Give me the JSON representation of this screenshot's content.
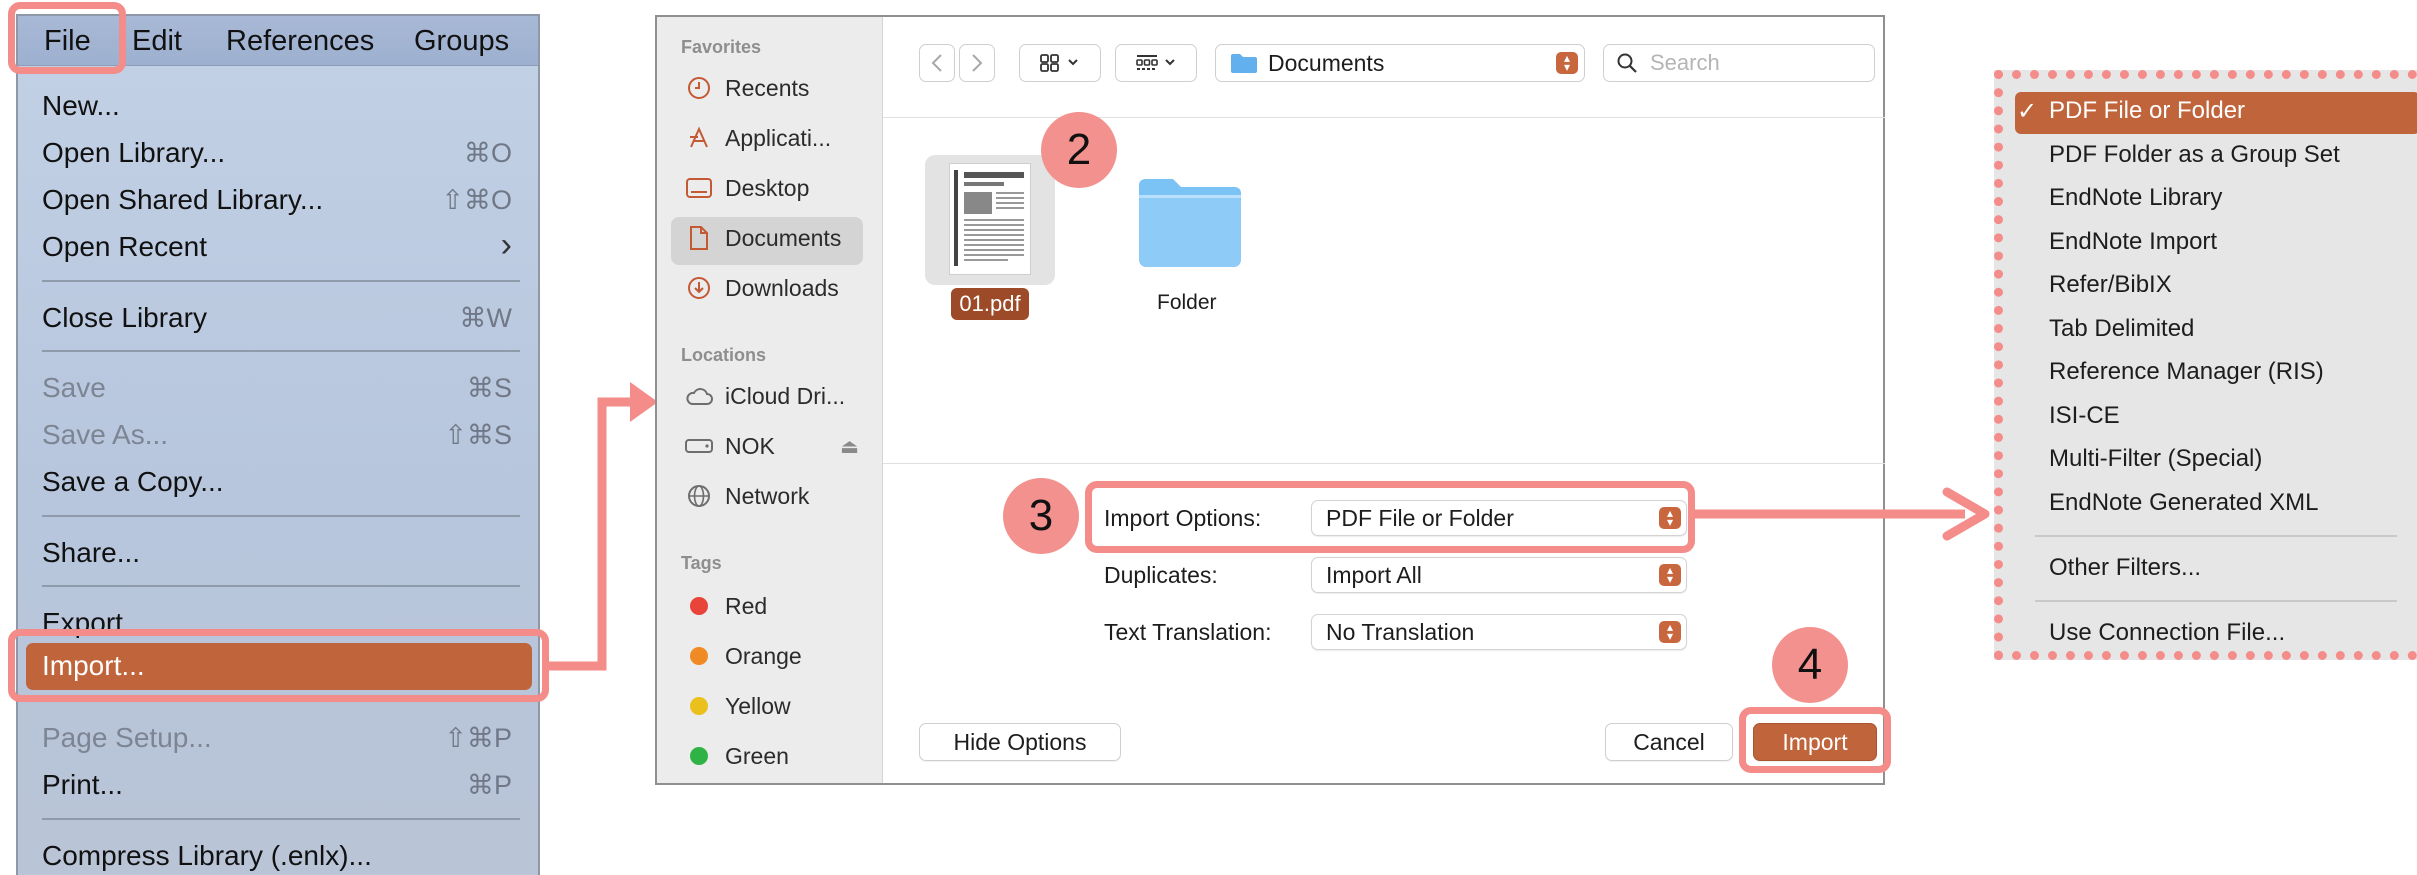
{
  "menu": {
    "bar": [
      "File",
      "Edit",
      "References",
      "Groups"
    ],
    "items": [
      {
        "label": "New...",
        "shortcut": ""
      },
      {
        "label": "Open Library...",
        "shortcut": "⌘O"
      },
      {
        "label": "Open Shared Library...",
        "shortcut": "⇧⌘O"
      },
      {
        "label": "Open Recent",
        "shortcut": "›"
      },
      {
        "label": "Close Library",
        "shortcut": "⌘W"
      },
      {
        "label": "Save",
        "shortcut": "⌘S"
      },
      {
        "label": "Save As...",
        "shortcut": "⇧⌘S"
      },
      {
        "label": "Save a Copy...",
        "shortcut": ""
      },
      {
        "label": "Share...",
        "shortcut": ""
      },
      {
        "label": "Export...",
        "shortcut": ""
      },
      {
        "label": "Import...",
        "shortcut": ""
      },
      {
        "label": "Page Setup...",
        "shortcut": "⇧⌘P"
      },
      {
        "label": "Print...",
        "shortcut": "⌘P"
      },
      {
        "label": "Compress Library (.enlx)...",
        "shortcut": ""
      }
    ]
  },
  "dialog": {
    "sidebar": {
      "favorites_header": "Favorites",
      "favorites": [
        "Recents",
        "Applicati...",
        "Desktop",
        "Documents",
        "Downloads"
      ],
      "locations_header": "Locations",
      "locations": [
        "iCloud Dri...",
        "NOK",
        "Network"
      ],
      "tags_header": "Tags",
      "tags": [
        {
          "label": "Red",
          "color": "#e8443a"
        },
        {
          "label": "Orange",
          "color": "#f08a24"
        },
        {
          "label": "Yellow",
          "color": "#e9c01c"
        },
        {
          "label": "Green",
          "color": "#2fb344"
        }
      ]
    },
    "location": "Documents",
    "search_placeholder": "Search",
    "files": [
      {
        "name": "01.pdf",
        "kind": "pdf",
        "selected": true
      },
      {
        "name": "Folder",
        "kind": "folder",
        "selected": false
      }
    ],
    "options": {
      "import_label": "Import Options:",
      "import_value": "PDF File or Folder",
      "duplicates_label": "Duplicates:",
      "duplicates_value": "Import All",
      "translation_label": "Text Translation:",
      "translation_value": "No Translation"
    },
    "buttons": {
      "hide_options": "Hide Options",
      "cancel": "Cancel",
      "import": "Import"
    }
  },
  "steps": [
    "2",
    "3",
    "4"
  ],
  "import_options_menu": {
    "items": [
      "PDF File or Folder",
      "PDF Folder as a Group Set",
      "EndNote Library",
      "EndNote Import",
      "Refer/BibIX",
      "Tab Delimited",
      "Reference Manager (RIS)",
      "ISI-CE",
      "Multi-Filter (Special)",
      "EndNote Generated XML",
      "Other Filters...",
      "Use Connection File..."
    ],
    "checkmark": "✓"
  },
  "colors": {
    "accent": "#c0643c",
    "highlight": "#f48c8a"
  }
}
